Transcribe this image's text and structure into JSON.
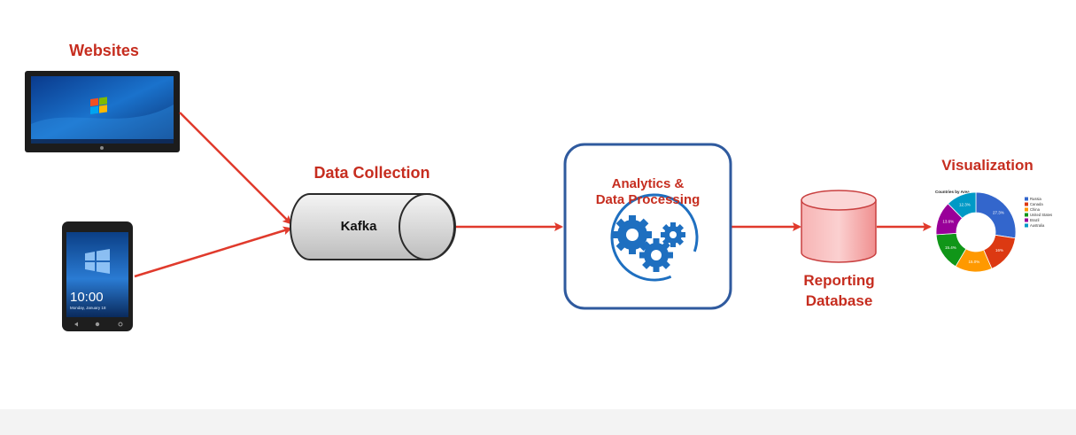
{
  "labels": {
    "websites": "Websites",
    "data_collection": "Data Collection",
    "kafka": "Kafka",
    "analytics_line1": "Analytics &",
    "analytics_line2": "Data Processing",
    "reporting_line1": "Reporting",
    "reporting_line2": "Database",
    "visualization": "Visualization"
  },
  "phone": {
    "time": "10:00",
    "date": "Monday, January 18"
  },
  "donut_chart": {
    "title": "Countries by Area",
    "slices": [
      {
        "name": "Russia",
        "value": 27.3,
        "label": "27.3%",
        "color": "#3366cc"
      },
      {
        "name": "Canada",
        "value": 16,
        "label": "16%",
        "color": "#dc3912"
      },
      {
        "name": "China",
        "value": 15.0,
        "label": "15.0%",
        "color": "#ff9900"
      },
      {
        "name": "United States",
        "value": 15.4,
        "label": "15.4%",
        "color": "#109618"
      },
      {
        "name": "Brazil",
        "value": 13.6,
        "label": "13.6%",
        "color": "#990099"
      },
      {
        "name": "Australia",
        "value": 12.3,
        "label": "12.3%",
        "color": "#0099c6"
      }
    ]
  },
  "colors": {
    "accent_red": "#c62d1f",
    "arrow_red": "#e03a2c",
    "analytics_border": "#2f5a9e",
    "gear_blue": "#1e6fc0",
    "database_fill": "#f6a8a8"
  }
}
